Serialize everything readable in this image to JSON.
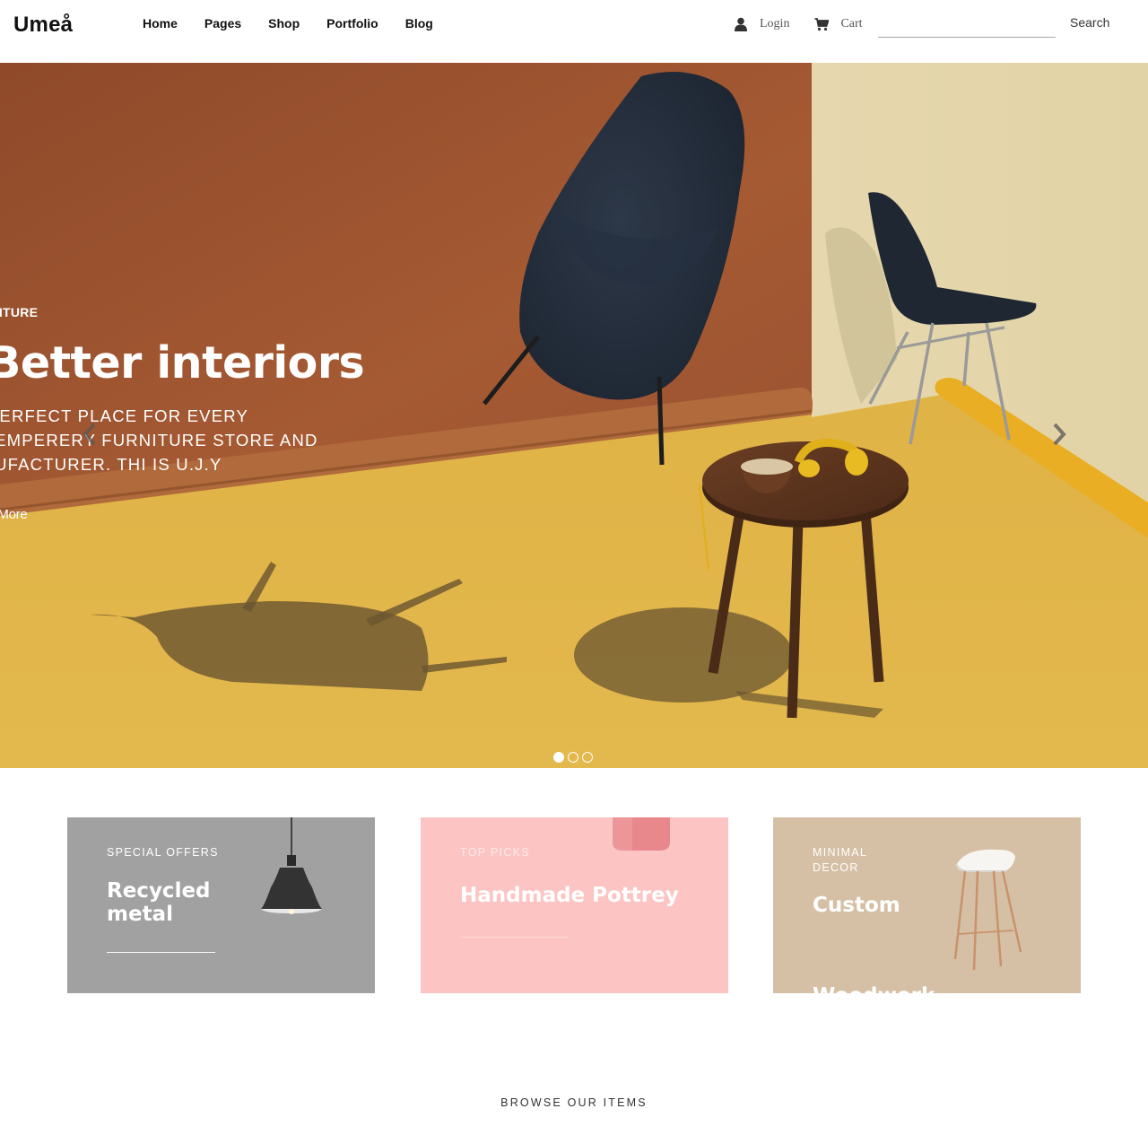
{
  "header": {
    "logo": "Umeå",
    "nav": [
      "Home",
      "Pages",
      "Shop",
      "Portfolio",
      "Blog"
    ],
    "login_label": "Login",
    "login_icon": "user-icon",
    "cart_label": "Cart",
    "cart_icon": "cart-icon",
    "search_value": "",
    "search_button": "Search"
  },
  "hero": {
    "kicker": "RNITURE",
    "title": "Better interiors",
    "subtitle_lines": [
      "E PERFECT PLACE FOR EVERY",
      "OTEMPERERY FURNITURE STORE AND",
      "ANUFACTURER. THI IS U.J.Y"
    ],
    "button": "iw More",
    "slide_count": 3,
    "active_slide": 1
  },
  "promos": [
    {
      "kicker": "SPECIAL OFFERS",
      "title": "Recycled metal",
      "accent": "#a1a1a1"
    },
    {
      "kicker": "TOP PICKS",
      "title": "Handmade Pottrey",
      "accent": "#fcc5c3"
    },
    {
      "kicker": "MINIMAL DECOR",
      "title": "Custom",
      "title_cut": "Woodwork",
      "accent": "#d5c0a6"
    }
  ],
  "browse": {
    "title": "BROWSE OUR ITEMS",
    "faint": "· · · · · · · · · ·"
  }
}
